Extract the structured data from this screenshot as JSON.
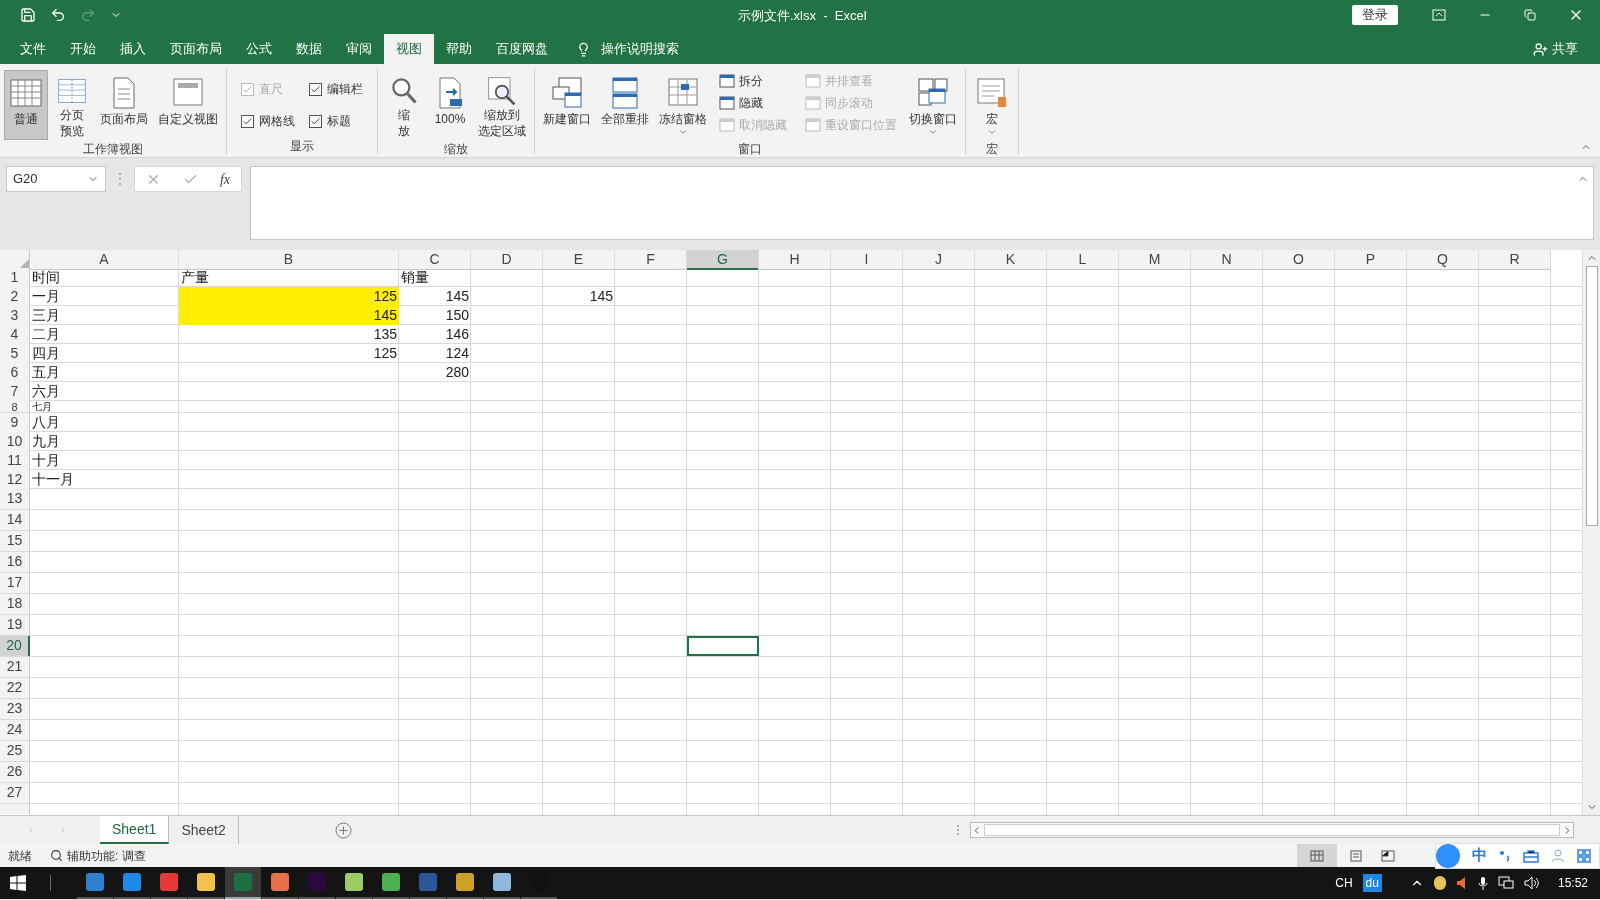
{
  "window": {
    "title": "示例文件.xlsx  -  Excel",
    "sign_in": "登录"
  },
  "menu_tabs": [
    {
      "label": "文件",
      "selected": false
    },
    {
      "label": "开始",
      "selected": false
    },
    {
      "label": "插入",
      "selected": false
    },
    {
      "label": "页面布局",
      "selected": false
    },
    {
      "label": "公式",
      "selected": false
    },
    {
      "label": "数据",
      "selected": false
    },
    {
      "label": "审阅",
      "selected": false
    },
    {
      "label": "视图",
      "selected": true
    },
    {
      "label": "帮助",
      "selected": false
    },
    {
      "label": "百度网盘",
      "selected": false
    }
  ],
  "search": {
    "label": "操作说明搜索"
  },
  "share": "共享",
  "ribbon_groups": [
    {
      "title": "工作簿视图",
      "items": [
        {
          "kind": "large",
          "lines": [
            "普通"
          ],
          "selected": true,
          "dropdown": false
        },
        {
          "kind": "large",
          "lines": [
            "分页",
            "预览"
          ],
          "selected": false,
          "dropdown": false
        },
        {
          "kind": "large",
          "lines": [
            "页面布局"
          ],
          "selected": false,
          "dropdown": false
        },
        {
          "kind": "large",
          "lines": [
            "自定义视图"
          ],
          "selected": false,
          "dropdown": false
        }
      ]
    },
    {
      "title": "显示",
      "items": [
        {
          "kind": "checkbox",
          "label": "直尺",
          "checked": true,
          "disabled": true
        },
        {
          "kind": "checkbox",
          "label": "编辑栏",
          "checked": true,
          "disabled": false
        },
        {
          "kind": "checkbox",
          "label": "网格线",
          "checked": true,
          "disabled": false
        },
        {
          "kind": "checkbox",
          "label": "标题",
          "checked": true,
          "disabled": false
        }
      ]
    },
    {
      "title": "缩放",
      "items": [
        {
          "kind": "large",
          "lines": [
            "缩",
            "放"
          ],
          "selected": false,
          "dropdown": false
        },
        {
          "kind": "large",
          "lines": [
            "100%"
          ],
          "selected": false,
          "dropdown": false
        },
        {
          "kind": "large",
          "lines": [
            "缩放到",
            "选定区域"
          ],
          "selected": false,
          "dropdown": false
        }
      ]
    },
    {
      "title": "窗口",
      "items": [
        {
          "kind": "large",
          "lines": [
            "新建窗口"
          ],
          "selected": false,
          "dropdown": false
        },
        {
          "kind": "large",
          "lines": [
            "全部重排"
          ],
          "selected": false,
          "dropdown": false
        },
        {
          "kind": "large",
          "lines": [
            "冻结窗格"
          ],
          "selected": false,
          "dropdown": true
        },
        {
          "kind": "small",
          "label": "拆分",
          "disabled": false
        },
        {
          "kind": "small",
          "label": "隐藏",
          "disabled": false
        },
        {
          "kind": "small",
          "label": "取消隐藏",
          "disabled": true
        },
        {
          "kind": "small",
          "label": "并排查看",
          "disabled": true
        },
        {
          "kind": "small",
          "label": "同步滚动",
          "disabled": true
        },
        {
          "kind": "small",
          "label": "重设窗口位置",
          "disabled": true
        },
        {
          "kind": "large",
          "lines": [
            "切换窗口"
          ],
          "selected": false,
          "dropdown": true
        }
      ]
    },
    {
      "title": "宏",
      "items": [
        {
          "kind": "large",
          "lines": [
            "宏"
          ],
          "selected": false,
          "dropdown": true
        }
      ]
    }
  ],
  "name_box": "G20",
  "formula_button": "fx",
  "columns": [
    {
      "label": "A",
      "selected": false
    },
    {
      "label": "B",
      "selected": false
    },
    {
      "label": "C",
      "selected": false
    },
    {
      "label": "D",
      "selected": false
    },
    {
      "label": "E",
      "selected": false
    },
    {
      "label": "F",
      "selected": false
    },
    {
      "label": "G",
      "selected": true
    },
    {
      "label": "H",
      "selected": false
    },
    {
      "label": "I",
      "selected": false
    },
    {
      "label": "J",
      "selected": false
    },
    {
      "label": "K",
      "selected": false
    },
    {
      "label": "L",
      "selected": false
    },
    {
      "label": "M",
      "selected": false
    },
    {
      "label": "N",
      "selected": false
    },
    {
      "label": "O",
      "selected": false
    },
    {
      "label": "P",
      "selected": false
    },
    {
      "label": "Q",
      "selected": false
    },
    {
      "label": "R",
      "selected": false
    }
  ],
  "rows": [
    {
      "label": "1",
      "selected": false,
      "cells": [
        {
          "text": "时间",
          "kind": "text",
          "highlighted": false
        },
        {
          "text": "产量",
          "kind": "text",
          "highlighted": false
        },
        {
          "text": "销量",
          "kind": "text",
          "highlighted": false
        }
      ]
    },
    {
      "label": "2",
      "selected": false,
      "cells": [
        {
          "text": "一月",
          "kind": "text",
          "highlighted": false
        },
        {
          "text": "125",
          "kind": "number",
          "highlighted": true
        },
        {
          "text": "145",
          "kind": "number",
          "highlighted": false
        },
        null,
        {
          "text": "145",
          "kind": "number",
          "highlighted": false
        }
      ]
    },
    {
      "label": "3",
      "selected": false,
      "cells": [
        {
          "text": "三月",
          "kind": "text",
          "highlighted": false
        },
        {
          "text": "145",
          "kind": "number",
          "highlighted": true
        },
        {
          "text": "150",
          "kind": "number",
          "highlighted": false
        }
      ]
    },
    {
      "label": "4",
      "selected": false,
      "cells": [
        {
          "text": "二月",
          "kind": "text",
          "highlighted": false
        },
        {
          "text": "135",
          "kind": "number",
          "highlighted": false
        },
        {
          "text": "146",
          "kind": "number",
          "highlighted": false
        }
      ]
    },
    {
      "label": "5",
      "selected": false,
      "cells": [
        {
          "text": "四月",
          "kind": "text",
          "highlighted": false
        },
        {
          "text": "125",
          "kind": "number",
          "highlighted": false
        },
        {
          "text": "124",
          "kind": "number",
          "highlighted": false
        }
      ]
    },
    {
      "label": "6",
      "selected": false,
      "cells": [
        {
          "text": "五月",
          "kind": "text",
          "highlighted": false
        },
        null,
        {
          "text": "280",
          "kind": "number",
          "highlighted": false
        }
      ]
    },
    {
      "label": "7",
      "selected": false,
      "cells": [
        {
          "text": "六月",
          "kind": "text",
          "highlighted": false
        }
      ]
    },
    {
      "label": "8",
      "selected": false,
      "cells": [
        {
          "text": "七月",
          "kind": "text",
          "highlighted": false
        }
      ]
    },
    {
      "label": "9",
      "selected": false,
      "cells": [
        {
          "text": "八月",
          "kind": "text",
          "highlighted": false
        }
      ]
    },
    {
      "label": "10",
      "selected": false,
      "cells": [
        {
          "text": "九月",
          "kind": "text",
          "highlighted": false
        }
      ]
    },
    {
      "label": "11",
      "selected": false,
      "cells": [
        {
          "text": "十月",
          "kind": "text",
          "highlighted": false
        }
      ]
    },
    {
      "label": "12",
      "selected": false,
      "cells": [
        {
          "text": "十一月",
          "kind": "text",
          "highlighted": false
        }
      ]
    },
    {
      "label": "13",
      "selected": false
    },
    {
      "label": "14",
      "selected": false
    },
    {
      "label": "15",
      "selected": false
    },
    {
      "label": "16",
      "selected": false
    },
    {
      "label": "17",
      "selected": false
    },
    {
      "label": "18",
      "selected": false
    },
    {
      "label": "19",
      "selected": false
    },
    {
      "label": "20",
      "selected": true
    },
    {
      "label": "21",
      "selected": false
    },
    {
      "label": "22",
      "selected": false
    },
    {
      "label": "23",
      "selected": false
    },
    {
      "label": "24",
      "selected": false
    },
    {
      "label": "25",
      "selected": false
    },
    {
      "label": "26",
      "selected": false
    },
    {
      "label": "27",
      "selected": false
    }
  ],
  "sheet_tabs": [
    {
      "label": "Sheet1",
      "selected": true
    },
    {
      "label": "Sheet2",
      "selected": false
    }
  ],
  "status_bar": {
    "ready": "就绪",
    "accessibility": "辅助功能: 调查"
  },
  "ime_toolbar": {
    "mode": "中"
  },
  "taskbar": {
    "language": "CH",
    "ime_badge": "du",
    "time": "15:52",
    "apps": [
      {
        "color": "#2f7fd1",
        "selected": false
      },
      {
        "color": "#1e88e5",
        "selected": false
      },
      {
        "color": "#e53935",
        "selected": false
      },
      {
        "color": "#f2c14e",
        "selected": false
      },
      {
        "color": "#1d6f42",
        "selected": true
      },
      {
        "color": "#e8704a",
        "selected": false
      },
      {
        "color": "#2a0a3c",
        "selected": false
      },
      {
        "color": "#9ccc65",
        "selected": false
      },
      {
        "color": "#4caf50",
        "selected": false
      },
      {
        "color": "#2b579a",
        "selected": false
      },
      {
        "color": "#c9a227",
        "selected": false
      },
      {
        "color": "#8fb8de",
        "selected": false
      },
      {
        "color": "#111111",
        "selected": false
      }
    ]
  }
}
